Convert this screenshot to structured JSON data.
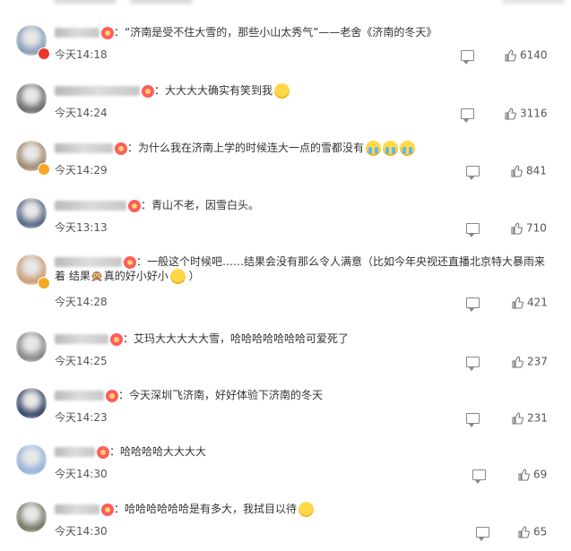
{
  "comments": [
    {
      "name_width": 50,
      "text": "：“济南是受不住大雪的，那些小山太秀气”——老舍《济南的冬天》",
      "time": "今天14:18",
      "likes": "6140",
      "avatar": "#8aa0b8",
      "verified": "red",
      "emojis": []
    },
    {
      "name_width": 95,
      "text": "：大大大大确实有笑到我",
      "time": "今天14:24",
      "likes": "3116",
      "avatar": "#6f6f6f",
      "verified": "",
      "emojis": [
        "laugh"
      ]
    },
    {
      "name_width": 65,
      "text": "：为什么我在济南上学的时候连大一点的雪都没有",
      "time": "今天14:29",
      "likes": "841",
      "avatar": "#a08a70",
      "verified": "gold",
      "emojis": [
        "cry",
        "cry",
        "cry"
      ]
    },
    {
      "name_width": 80,
      "text": "：青山不老，因雪白头。",
      "time": "今天13:13",
      "likes": "710",
      "avatar": "#5a6a8a",
      "verified": "",
      "emojis": []
    },
    {
      "name_width": 75,
      "text": "：一般这个时候吧……结果会没有那么令人满意（比如今年央视还直播北京特大暴雨来",
      "text2": "着 结果🙊真的好小好小",
      "text3": "）",
      "time": "今天14:28",
      "likes": "421",
      "avatar": "#c9a07a",
      "verified": "gold",
      "emojis": []
    },
    {
      "name_width": 60,
      "text": "：艾玛大大大大大雪，哈哈哈哈哈哈哈可爱死了",
      "time": "今天14:25",
      "likes": "237",
      "avatar": "#8a8a8a",
      "verified": "",
      "emojis": []
    },
    {
      "name_width": 55,
      "text": "：今天深圳飞济南，好好体验下济南的冬天",
      "time": "今天14:23",
      "likes": "231",
      "avatar": "#3a4a6a",
      "verified": "",
      "emojis": []
    },
    {
      "name_width": 45,
      "text": "：哈哈哈哈大大大大",
      "time": "今天14:30",
      "likes": "69",
      "avatar": "#9ab4d8",
      "verified": "",
      "emojis": []
    },
    {
      "name_width": 50,
      "text": "：哈哈哈哈哈哈是有多大，我拭目以待",
      "time": "今天14:30",
      "likes": "65",
      "avatar": "#7a7a6a",
      "verified": "",
      "emojis": [
        "cat"
      ]
    }
  ]
}
